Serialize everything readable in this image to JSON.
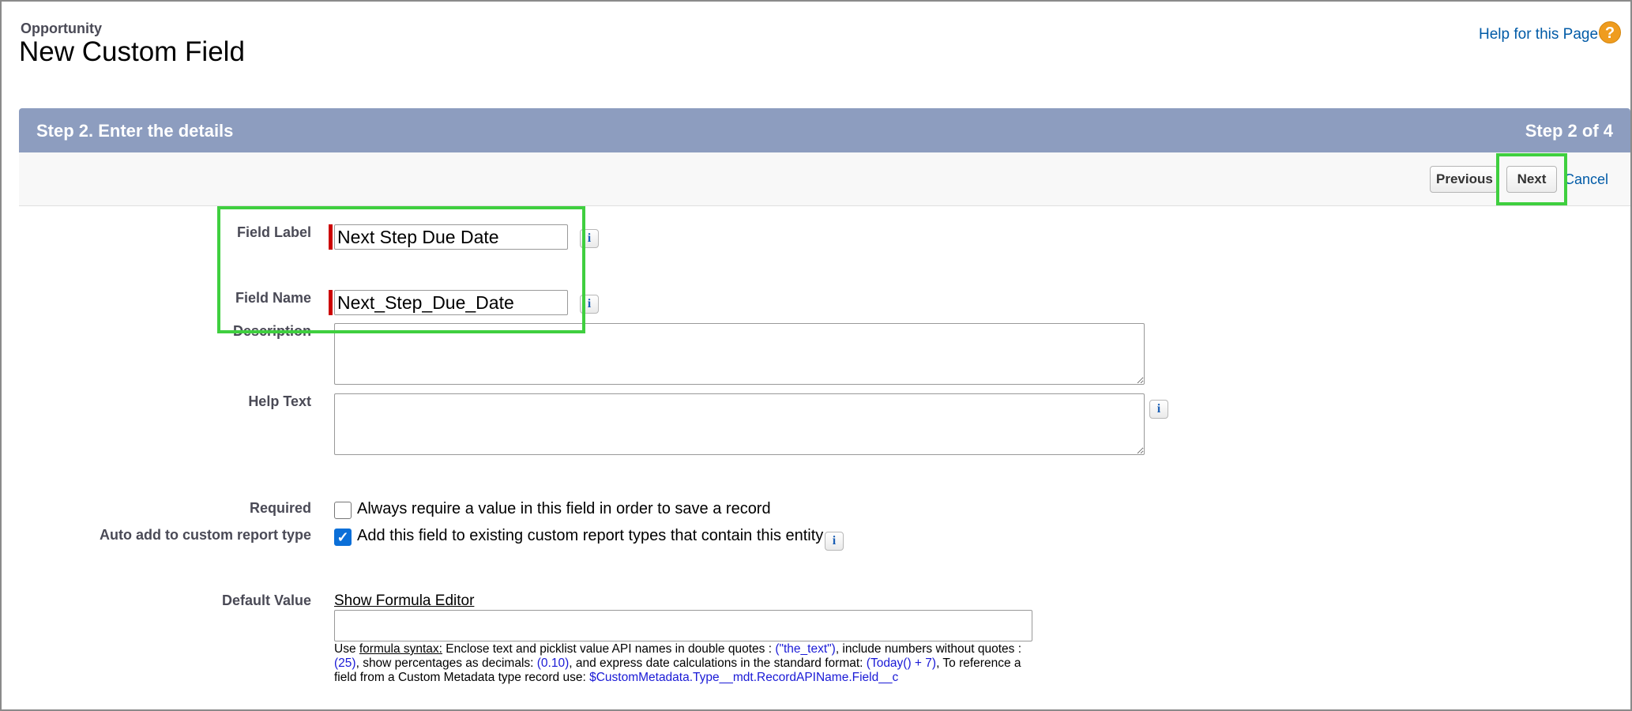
{
  "header": {
    "object_label": "Opportunity",
    "page_title": "New Custom Field",
    "help_link": "Help for this Page",
    "help_icon": "question-icon"
  },
  "step": {
    "title": "Step 2. Enter the details",
    "count": "Step 2 of 4"
  },
  "buttons": {
    "previous": "Previous",
    "next": "Next",
    "cancel": "Cancel"
  },
  "form": {
    "field_label": {
      "label": "Field Label",
      "value": "Next Step Due Date"
    },
    "field_name": {
      "label": "Field Name",
      "value": "Next_Step_Due_Date"
    },
    "description": {
      "label": "Description",
      "value": ""
    },
    "help_text": {
      "label": "Help Text",
      "value": ""
    },
    "required": {
      "label": "Required",
      "text": "Always require a value in this field in order to save a record",
      "checked": false
    },
    "auto_add": {
      "label": "Auto add to custom report type",
      "text": "Add this field to existing custom report types that contain this entity",
      "checked": true
    },
    "default_value": {
      "label": "Default Value",
      "formula_link": "Show Formula Editor",
      "value": "",
      "hint": {
        "use": "Use ",
        "syntax_link": "formula syntax:",
        "p1": " Enclose text and picklist value API names in double quotes : ",
        "ex1": "(\"the_text\")",
        "p2": ", include numbers without quotes : ",
        "ex2": "(25)",
        "p3": ", show percentages as decimals: ",
        "ex3": "(0.10)",
        "p4": ", and express date calculations in the standard format: ",
        "ex4": "(Today() + 7)",
        "p5": ", To reference a field from a Custom Metadata type record use: ",
        "ex5": "$CustomMetadata.Type__mdt.RecordAPIName.Field__c"
      }
    }
  },
  "info_icon_glyph": "i",
  "colors": {
    "step_header": "#8d9dbf",
    "link": "#015ba7",
    "required_bar": "#cc0000",
    "highlight": "#3fcf3f"
  }
}
